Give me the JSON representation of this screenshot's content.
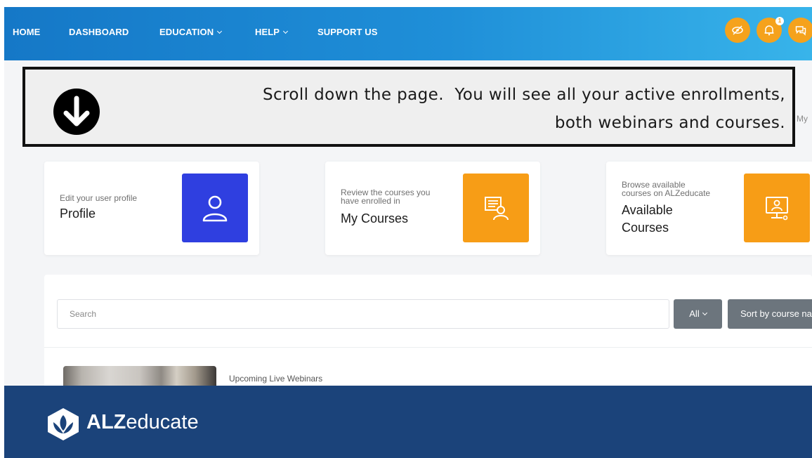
{
  "nav": {
    "items": [
      {
        "label": "HOME"
      },
      {
        "label": "DASHBOARD"
      },
      {
        "label": "EDUCATION"
      },
      {
        "label": "HELP"
      },
      {
        "label": "SUPPORT US"
      }
    ],
    "notification_count": "1",
    "icons": [
      "eye-slash-icon",
      "bell-icon",
      "chat-icon"
    ]
  },
  "callout": {
    "line1": "Scroll down the page.  You will see all your active enrollments,",
    "line2": "both webinars and courses.",
    "icon": "arrow-down-circle-icon",
    "behind_text": "My"
  },
  "cards": [
    {
      "subtitle": "Edit your user profile",
      "title": "Profile",
      "icon": "user-icon",
      "color": "#2f3fe0"
    },
    {
      "subtitle_line1": "Review the courses you",
      "subtitle_line2": "have enrolled in",
      "title": "My Courses",
      "icon": "course-icon",
      "color": "#f79d16"
    },
    {
      "subtitle_line1": "Browse available",
      "subtitle_line2": "courses on ALZeducate",
      "title_line1": "Available",
      "title_line2": "Courses",
      "icon": "monitor-user-icon",
      "color": "#f79d16"
    }
  ],
  "courses": {
    "search_placeholder": "Search",
    "filter_label": "All",
    "sort_label": "Sort by course na",
    "item_label": "Upcoming Live Webinars"
  },
  "brand": {
    "name_bold": "ALZ",
    "name_rest": "educate",
    "bar_color": "#1b437a"
  }
}
